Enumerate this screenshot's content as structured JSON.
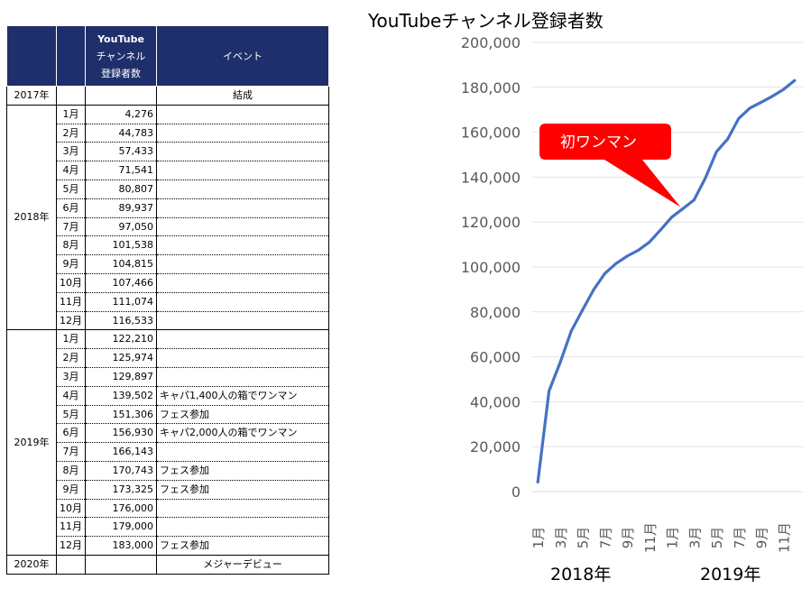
{
  "table": {
    "headers": {
      "value_line1": "YouTube",
      "value_line2": "チャンネル",
      "value_line3": "登録者数",
      "event": "イベント"
    },
    "pre_row": {
      "year": "2017年",
      "month": "",
      "value": "",
      "event": "結成"
    },
    "groups": [
      {
        "year": "2018年",
        "rows": [
          {
            "month": "1月",
            "value": "4,276",
            "event": ""
          },
          {
            "month": "2月",
            "value": "44,783",
            "event": ""
          },
          {
            "month": "3月",
            "value": "57,433",
            "event": ""
          },
          {
            "month": "4月",
            "value": "71,541",
            "event": ""
          },
          {
            "month": "5月",
            "value": "80,807",
            "event": ""
          },
          {
            "month": "6月",
            "value": "89,937",
            "event": ""
          },
          {
            "month": "7月",
            "value": "97,050",
            "event": ""
          },
          {
            "month": "8月",
            "value": "101,538",
            "event": ""
          },
          {
            "month": "9月",
            "value": "104,815",
            "event": ""
          },
          {
            "month": "10月",
            "value": "107,466",
            "event": ""
          },
          {
            "month": "11月",
            "value": "111,074",
            "event": ""
          },
          {
            "month": "12月",
            "value": "116,533",
            "event": ""
          }
        ]
      },
      {
        "year": "2019年",
        "rows": [
          {
            "month": "1月",
            "value": "122,210",
            "event": ""
          },
          {
            "month": "2月",
            "value": "125,974",
            "event": ""
          },
          {
            "month": "3月",
            "value": "129,897",
            "event": ""
          },
          {
            "month": "4月",
            "value": "139,502",
            "event": "キャパ1,400人の箱でワンマン"
          },
          {
            "month": "5月",
            "value": "151,306",
            "event": "フェス参加"
          },
          {
            "month": "6月",
            "value": "156,930",
            "event": "キャパ2,000人の箱でワンマン"
          },
          {
            "month": "7月",
            "value": "166,143",
            "event": ""
          },
          {
            "month": "8月",
            "value": "170,743",
            "event": "フェス参加"
          },
          {
            "month": "9月",
            "value": "173,325",
            "event": "フェス参加"
          },
          {
            "month": "10月",
            "value": "176,000",
            "event": ""
          },
          {
            "month": "11月",
            "value": "179,000",
            "event": ""
          },
          {
            "month": "12月",
            "value": "183,000",
            "event": "フェス参加"
          }
        ]
      }
    ],
    "post_row": {
      "year": "2020年",
      "month": "",
      "value": "",
      "event": "メジャーデビュー"
    }
  },
  "chart_data": {
    "type": "line",
    "title": "YouTubeチャンネル登録者数",
    "ylim": [
      0,
      200000
    ],
    "yticks": [
      "0",
      "20,000",
      "40,000",
      "60,000",
      "80,000",
      "100,000",
      "120,000",
      "140,000",
      "160,000",
      "180,000",
      "200,000"
    ],
    "grid": true,
    "line_color": "#4472c4",
    "x": [
      "1月",
      "2月",
      "3月",
      "4月",
      "5月",
      "6月",
      "7月",
      "8月",
      "9月",
      "10月",
      "11月",
      "12月",
      "1月",
      "2月",
      "3月",
      "4月",
      "5月",
      "6月",
      "7月",
      "8月",
      "9月",
      "10月",
      "11月",
      "12月"
    ],
    "xtick_labels": [
      "1月",
      "3月",
      "5月",
      "7月",
      "9月",
      "11月",
      "1月",
      "3月",
      "5月",
      "7月",
      "9月",
      "11月"
    ],
    "year_labels": [
      "2018年",
      "2019年"
    ],
    "series": [
      {
        "values": [
          4276,
          44783,
          57433,
          71541,
          80807,
          89937,
          97050,
          101538,
          104815,
          107466,
          111074,
          116533,
          122210,
          125974,
          129897,
          139502,
          151306,
          156930,
          166143,
          170743,
          173325,
          176000,
          179000,
          183000
        ]
      }
    ],
    "annotation": {
      "text": "初ワンマン",
      "point_index": 14,
      "color": "#ff0000"
    }
  }
}
